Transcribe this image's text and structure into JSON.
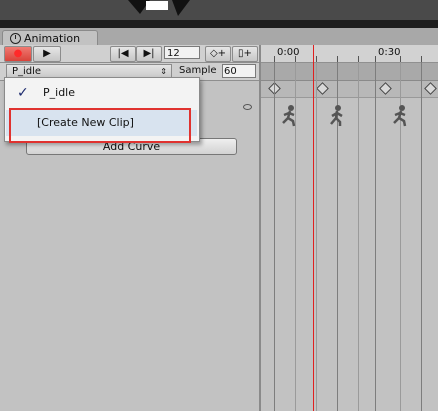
{
  "window": {
    "tab_label": "Animation"
  },
  "toolbar": {
    "record_icon": "record-dot-icon",
    "play_icon": "play-icon",
    "prev_key_icon": "prev-keyframe-icon",
    "next_key_icon": "next-keyframe-icon",
    "frame_value": "12",
    "add_keyframe_icon": "add-keyframe-icon",
    "add_event_icon": "add-event-icon"
  },
  "clip": {
    "selected": "P_idle",
    "sample_label": "Sample",
    "sample_value": "60"
  },
  "dropdown": {
    "items": [
      {
        "label": "P_idle",
        "checked": true
      },
      {
        "label": "[Create New Clip]",
        "checked": false,
        "highlighted": true
      }
    ]
  },
  "curves": {
    "add_curve_label": "Add Curve"
  },
  "timeline": {
    "ticks": [
      "0:00",
      "0:30"
    ],
    "playhead_color": "#e02020"
  },
  "annotation": {
    "highlight_color": "#e0322f"
  }
}
